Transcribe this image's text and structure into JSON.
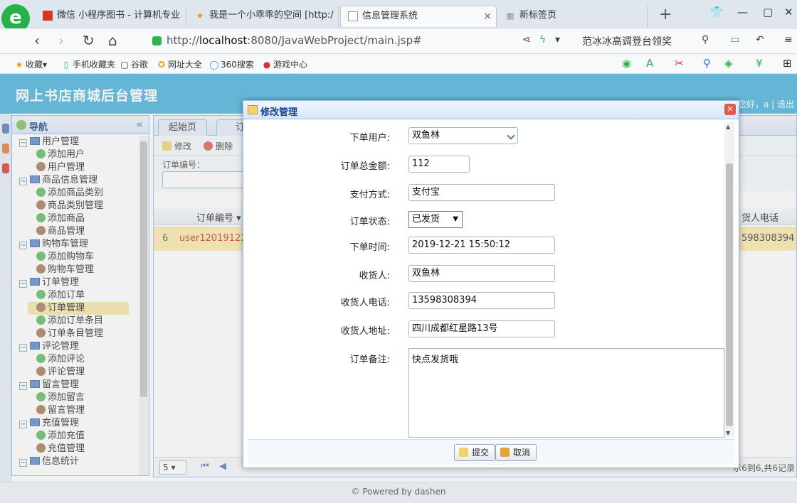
{
  "browser": {
    "tabs": [
      {
        "label": "微信 小程序图书 - 计算机专业",
        "icon": "red-square-icon"
      },
      {
        "label": "我是一个小乖乖的空间 [http:/",
        "icon": "star-icon"
      },
      {
        "label": "信息管理系统",
        "icon": "page-icon"
      },
      {
        "label": "新标签页",
        "icon": "grid-icon"
      }
    ],
    "close_glyph": "×",
    "url_prefix": "http://",
    "url_host": "localhost",
    "url_rest": ":8080/JavaWebProject/main.jsp#",
    "search_suggest": "范冰冰高调登台领奖",
    "favorites": [
      "收藏",
      "手机收藏夹",
      "谷歌",
      "网址大全",
      "360搜索",
      "游戏中心"
    ]
  },
  "app": {
    "title": "网上书店商城后台管理",
    "welcome": "您好，a",
    "logout": "退出"
  },
  "nav": {
    "title": "导航",
    "collapse": "«",
    "groups": [
      {
        "label": "用户管理",
        "items": [
          "添加用户",
          "用户管理"
        ]
      },
      {
        "label": "商品信息管理",
        "items": [
          "添加商品类别",
          "商品类别管理",
          "添加商品",
          "商品管理"
        ]
      },
      {
        "label": "购物车管理",
        "items": [
          "添加购物车",
          "购物车管理"
        ]
      },
      {
        "label": "订单管理",
        "items": [
          "添加订单",
          "订单管理",
          "添加订单条目",
          "订单条目管理"
        ]
      },
      {
        "label": "评论管理",
        "items": [
          "添加评论",
          "评论管理"
        ]
      },
      {
        "label": "留言管理",
        "items": [
          "添加留言",
          "留言管理"
        ]
      },
      {
        "label": "充值管理",
        "items": [
          "添加充值",
          "充值管理"
        ]
      },
      {
        "label": "信息统计",
        "items": []
      }
    ],
    "selected": "订单管理"
  },
  "center": {
    "tabs": [
      "起始页",
      "订"
    ],
    "toolbar": {
      "edit": "修改",
      "delete": "删除"
    },
    "filter_label": "订单编号：",
    "columns": {
      "order_no": "订单编号",
      "phone": "货人电话"
    },
    "row": {
      "num": "6",
      "order_no": "user12019122",
      "phone": "598308394"
    },
    "pager": {
      "size": "5",
      "info": "示6到6,共6记录"
    }
  },
  "footer": "© Powered by dashen",
  "dialog": {
    "title": "修改管理",
    "close": "×",
    "fields": [
      {
        "label": "下单用户:",
        "value": "双鱼林",
        "kind": "select"
      },
      {
        "label": "订单总金额:",
        "value": "112",
        "kind": "input"
      },
      {
        "label": "支付方式:",
        "value": "支付宝",
        "kind": "input"
      },
      {
        "label": "订单状态:",
        "value": "已发货",
        "kind": "nselect"
      },
      {
        "label": "下单时间:",
        "value": "2019-12-21 15:50:12",
        "kind": "input"
      },
      {
        "label": "收货人:",
        "value": "双鱼林",
        "kind": "input"
      },
      {
        "label": "收货人电话:",
        "value": "13598308394",
        "kind": "input"
      },
      {
        "label": "收货人地址:",
        "value": "四川成都红星路13号",
        "kind": "input"
      },
      {
        "label": "订单备注:",
        "value": "快点发货哦",
        "kind": "textarea"
      }
    ],
    "submit": "提交",
    "cancel": "取消"
  },
  "colors": {
    "header": "#45b1db",
    "selected_row": "#fbe8a8",
    "panel_border": "#99bbe8"
  }
}
